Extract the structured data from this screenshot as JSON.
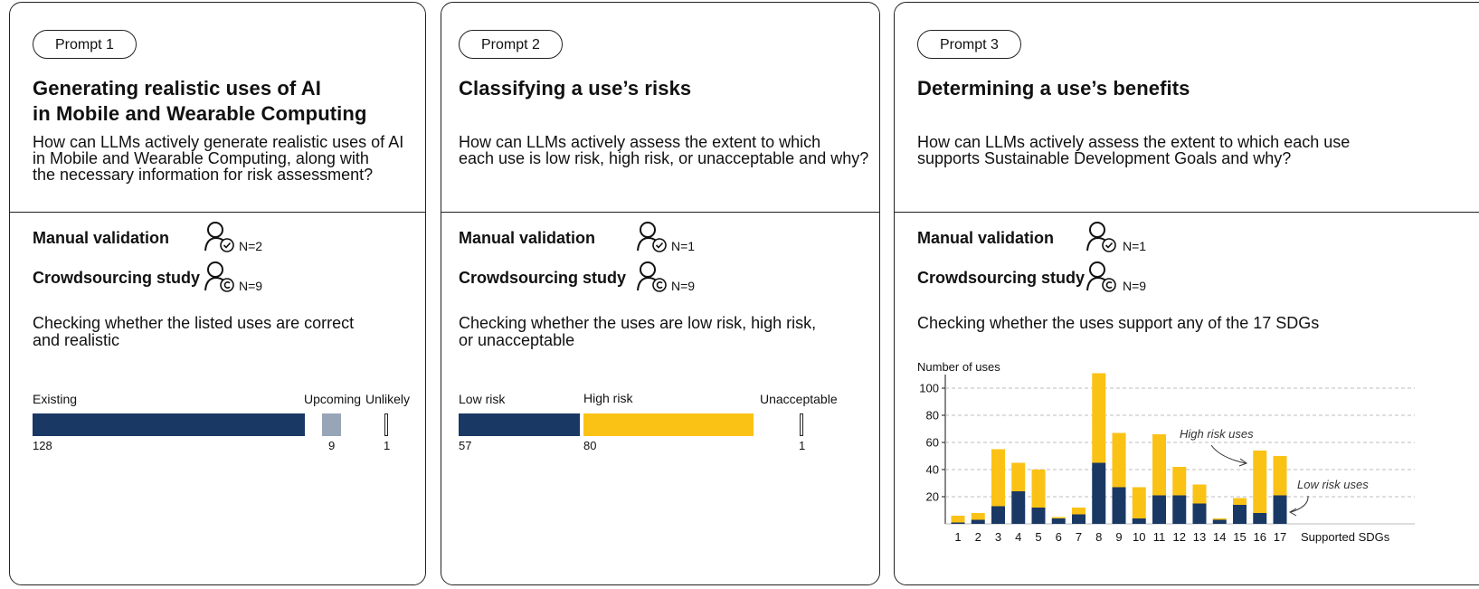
{
  "colors": {
    "navy": "#1a3864",
    "yellow": "#fbc216",
    "gray": "#97a5b6"
  },
  "panels": [
    {
      "prompt": "Prompt 1",
      "title": "Generating realistic uses of AI\nin Mobile and Wearable Computing",
      "question": "How can LLMs actively generate realistic uses of AI\nin Mobile and Wearable Computing, along with\nthe necessary information for risk assessment?",
      "manual_label": "Manual validation",
      "manual_n": "N=2",
      "crowd_label": "Crowdsourcing study",
      "crowd_n": "N=9",
      "task": "Checking whether the listed uses are correct\nand realistic",
      "bars": [
        {
          "label": "Existing",
          "value": 128,
          "color": "navy"
        },
        {
          "label": "Upcoming",
          "value": 9,
          "color": "gray"
        },
        {
          "label": "Unlikely",
          "value": 1,
          "color": "outline"
        }
      ]
    },
    {
      "prompt": "Prompt 2",
      "title": "Classifying a use’s risks",
      "question": "How can LLMs actively assess the extent to which\neach use is low risk, high risk, or unacceptable and why?",
      "manual_label": "Manual validation",
      "manual_n": "N=1",
      "crowd_label": "Crowdsourcing study",
      "crowd_n": "N=9",
      "task": "Checking whether the uses are low risk, high risk,\nor unacceptable",
      "bars": [
        {
          "label": "Low risk",
          "value": 57,
          "color": "navy"
        },
        {
          "label": "High risk",
          "value": 80,
          "color": "yellow"
        },
        {
          "label": "Unacceptable",
          "value": 1,
          "color": "outline"
        }
      ]
    },
    {
      "prompt": "Prompt 3",
      "title": "Determining a use’s benefits",
      "question": "How can LLMs actively assess the extent to which each use\nsupports Sustainable Development Goals and why?",
      "manual_label": "Manual validation",
      "manual_n": "N=1",
      "crowd_label": "Crowdsourcing study",
      "crowd_n": "N=9",
      "task": "Checking whether the uses support any of the 17 SDGs"
    }
  ],
  "chart_data": {
    "type": "bar",
    "stacked": true,
    "ylabel": "Number of uses",
    "xlabel": "Supported SDGs",
    "ylim": [
      0,
      110
    ],
    "yticks": [
      20,
      40,
      60,
      80,
      100
    ],
    "grid": true,
    "categories": [
      "1",
      "2",
      "3",
      "4",
      "5",
      "6",
      "7",
      "8",
      "9",
      "10",
      "11",
      "12",
      "13",
      "14",
      "15",
      "16",
      "17"
    ],
    "series": [
      {
        "color": "#1a3864",
        "values": [
          1,
          3,
          13,
          24,
          12,
          4,
          7,
          45,
          27,
          4,
          21,
          21,
          15,
          3,
          14,
          8,
          21
        ]
      },
      {
        "color": "#fbc216",
        "values": [
          5,
          5,
          42,
          21,
          28,
          1,
          5,
          66,
          40,
          23,
          45,
          21,
          14,
          1,
          5,
          46,
          29
        ]
      }
    ],
    "annotations": [
      "High risk uses",
      "Low risk uses"
    ]
  }
}
